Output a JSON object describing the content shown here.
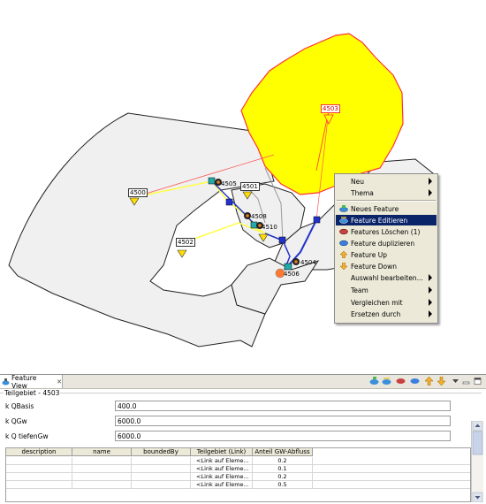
{
  "map": {
    "labels": [
      "4503",
      "4500",
      "4501",
      "4502",
      "4504",
      "4505",
      "4506",
      "4508",
      "4510"
    ]
  },
  "context_menu": {
    "items": [
      {
        "label": "Neu",
        "submenu": true,
        "icon": "none"
      },
      {
        "label": "Thema",
        "submenu": true,
        "icon": "none"
      },
      {
        "label": "Neues Feature",
        "submenu": false,
        "icon": "new-feature-icon"
      },
      {
        "label": "Feature Editieren",
        "submenu": false,
        "icon": "edit-feature-icon",
        "selected": true
      },
      {
        "label": "Features Löschen (1)",
        "submenu": false,
        "icon": "delete-features-icon"
      },
      {
        "label": "Feature duplizieren",
        "submenu": false,
        "icon": "duplicate-feature-icon"
      },
      {
        "label": "Feature Up",
        "submenu": false,
        "icon": "arrow-up-icon"
      },
      {
        "label": "Feature Down",
        "submenu": false,
        "icon": "arrow-down-icon"
      },
      {
        "label": "Auswahl bearbeiten...",
        "submenu": true,
        "icon": "none"
      },
      {
        "label": "Team",
        "submenu": true,
        "icon": "none"
      },
      {
        "label": "Vergleichen mit",
        "submenu": true,
        "icon": "none"
      },
      {
        "label": "Ersetzen durch",
        "submenu": true,
        "icon": "none"
      }
    ]
  },
  "feature_view": {
    "tab_label": "Feature View",
    "group_title": "Teilgebiet - 4503",
    "fields": [
      {
        "label": "k QBasis",
        "value": "400.0"
      },
      {
        "label": "k QGw",
        "value": "6000.0"
      },
      {
        "label": "k Q tiefenGw",
        "value": "6000.0"
      }
    ],
    "table": {
      "columns": [
        "description",
        "name",
        "boundedBy",
        "Teilgebiet (Link)",
        "Anteil GW-Abfluss"
      ],
      "rows": [
        [
          "",
          "",
          "",
          "<Link auf Eleme...",
          "0.2"
        ],
        [
          "",
          "",
          "",
          "<Link auf Eleme...",
          "0.1"
        ],
        [
          "",
          "",
          "",
          "<Link auf Eleme...",
          "0.2"
        ],
        [
          "",
          "",
          "",
          "<Link auf Eleme...",
          "0.5"
        ]
      ]
    }
  },
  "colors": {
    "highlight_polygon": "#ffff00",
    "selection": "#0a246a",
    "area_fill": "#f0f0f0"
  }
}
